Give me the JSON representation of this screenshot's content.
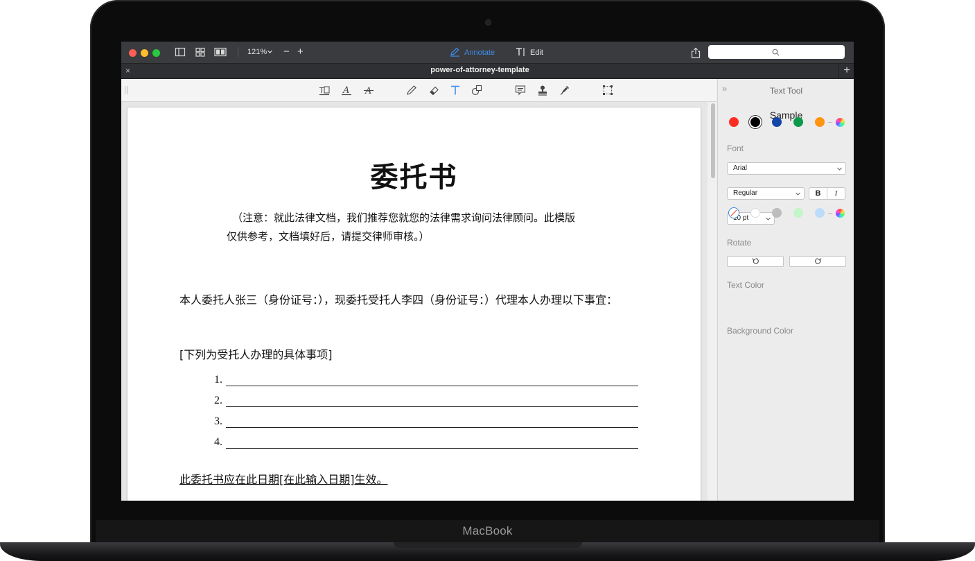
{
  "device": {
    "brand": "MacBook"
  },
  "toolbar": {
    "zoom": "121%",
    "zoom_out": "−",
    "zoom_in": "+",
    "annotate_label": "Annotate",
    "edit_label": "Edit",
    "accent": "#3f8ef0"
  },
  "tab": {
    "close": "×",
    "title": "power-of-attorney-template",
    "add": "+"
  },
  "document": {
    "title": "委托书",
    "note_line1": "（注意：就此法律文档，我们推荐您就您的法律需求询问法律顾问。此模版",
    "note_line2": "仅供参考，文档填好后，请提交律师审核。）",
    "paragraph": "本人委托人张三（身份证号：），现委托受托人李四（身份证号：）代理本人办理以下事宜：",
    "subheading": "[下列为受托人办理的具体事项]",
    "list": [
      "1.",
      "2.",
      "3.",
      "4."
    ],
    "effective": "此委托书应在此日期[在此输入日期]生效。"
  },
  "side_panel": {
    "collapse": "»",
    "title": "Text Tool",
    "sample": "Sample",
    "font_label": "Font",
    "font_value": "Arial",
    "style_value": "Regular",
    "bold": "B",
    "italic": "I",
    "size_value": "10 pt",
    "rotate_label": "Rotate",
    "text_color_label": "Text Color",
    "text_colors": [
      "#fe2d22",
      "#000000",
      "#1446a8",
      "#0b9a4a",
      "#ff9410"
    ],
    "background_color_label": "Background Color",
    "background_colors": [
      "#ffffff",
      "#bdbdbd",
      "#c4f5c8",
      "#bcdcfb"
    ]
  }
}
